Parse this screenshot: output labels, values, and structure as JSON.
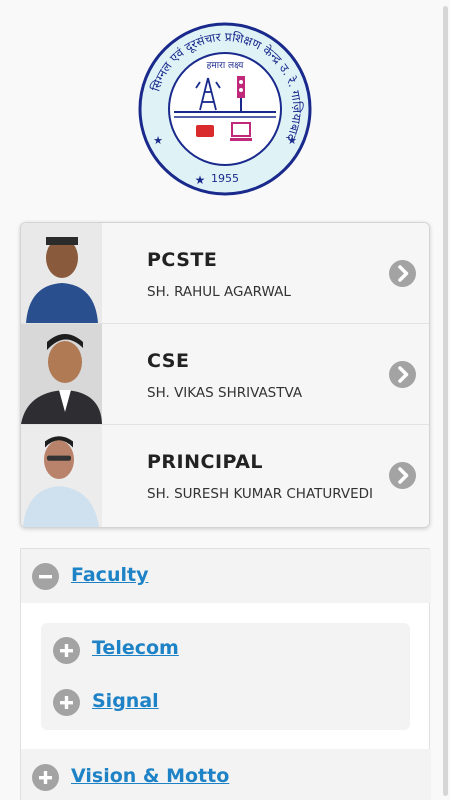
{
  "logo": {
    "top_text": "सिग्नल एवं दूरसंचार प्रशिक्षण केन्द्र उ. रे. गाज़ियाबाद",
    "inner_text": "हमारा लक्ष्य",
    "year": "1955",
    "ring_color": "#1a2a8c"
  },
  "people": [
    {
      "role": "PCSTE",
      "name": "SH. RAHUL AGARWAL"
    },
    {
      "role": "CSE",
      "name": "SH. VIKAS SHRIVASTVA"
    },
    {
      "role": "PRINCIPAL",
      "name": "SH. SURESH KUMAR CHATURVEDI"
    }
  ],
  "accordion": {
    "faculty_label": "Faculty",
    "sub_items": [
      {
        "label": "Telecom"
      },
      {
        "label": "Signal"
      }
    ],
    "vision_label": "Vision & Motto"
  },
  "colors": {
    "link": "#1e82c6",
    "icon": "#a3a3a3"
  }
}
